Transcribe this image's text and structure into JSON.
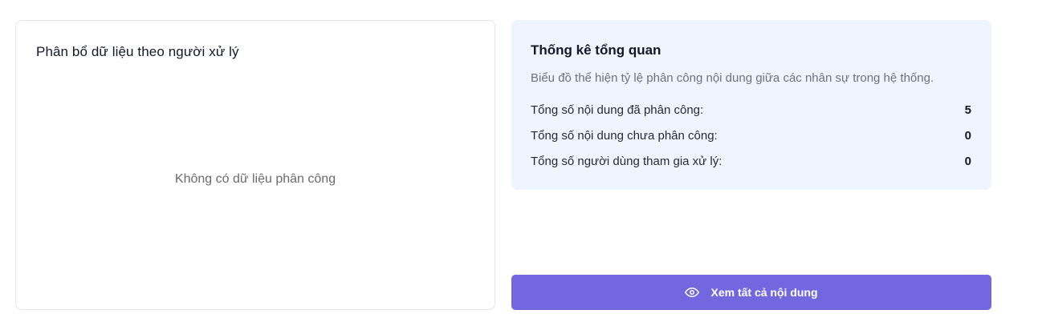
{
  "chart_panel": {
    "title": "Phân bổ dữ liệu theo người xử lý",
    "empty_message": "Không có dữ liệu phân công"
  },
  "stats_panel": {
    "title": "Thống kê tổng quan",
    "description": "Biểu đồ thể hiện tỷ lệ phân công nội dung giữa các nhân sự trong hệ thống.",
    "rows": [
      {
        "label": "Tổng số nội dung đã phân công:",
        "value": "5"
      },
      {
        "label": "Tổng số nội dung chưa phân công:",
        "value": "0"
      },
      {
        "label": "Tổng số người dùng tham gia xử lý:",
        "value": "0"
      }
    ]
  },
  "view_all_button": {
    "label": "Xem tất cả nội dung",
    "icon": "eye-icon"
  },
  "colors": {
    "accent": "#7367e0",
    "stats_background": "#eef5ff"
  }
}
